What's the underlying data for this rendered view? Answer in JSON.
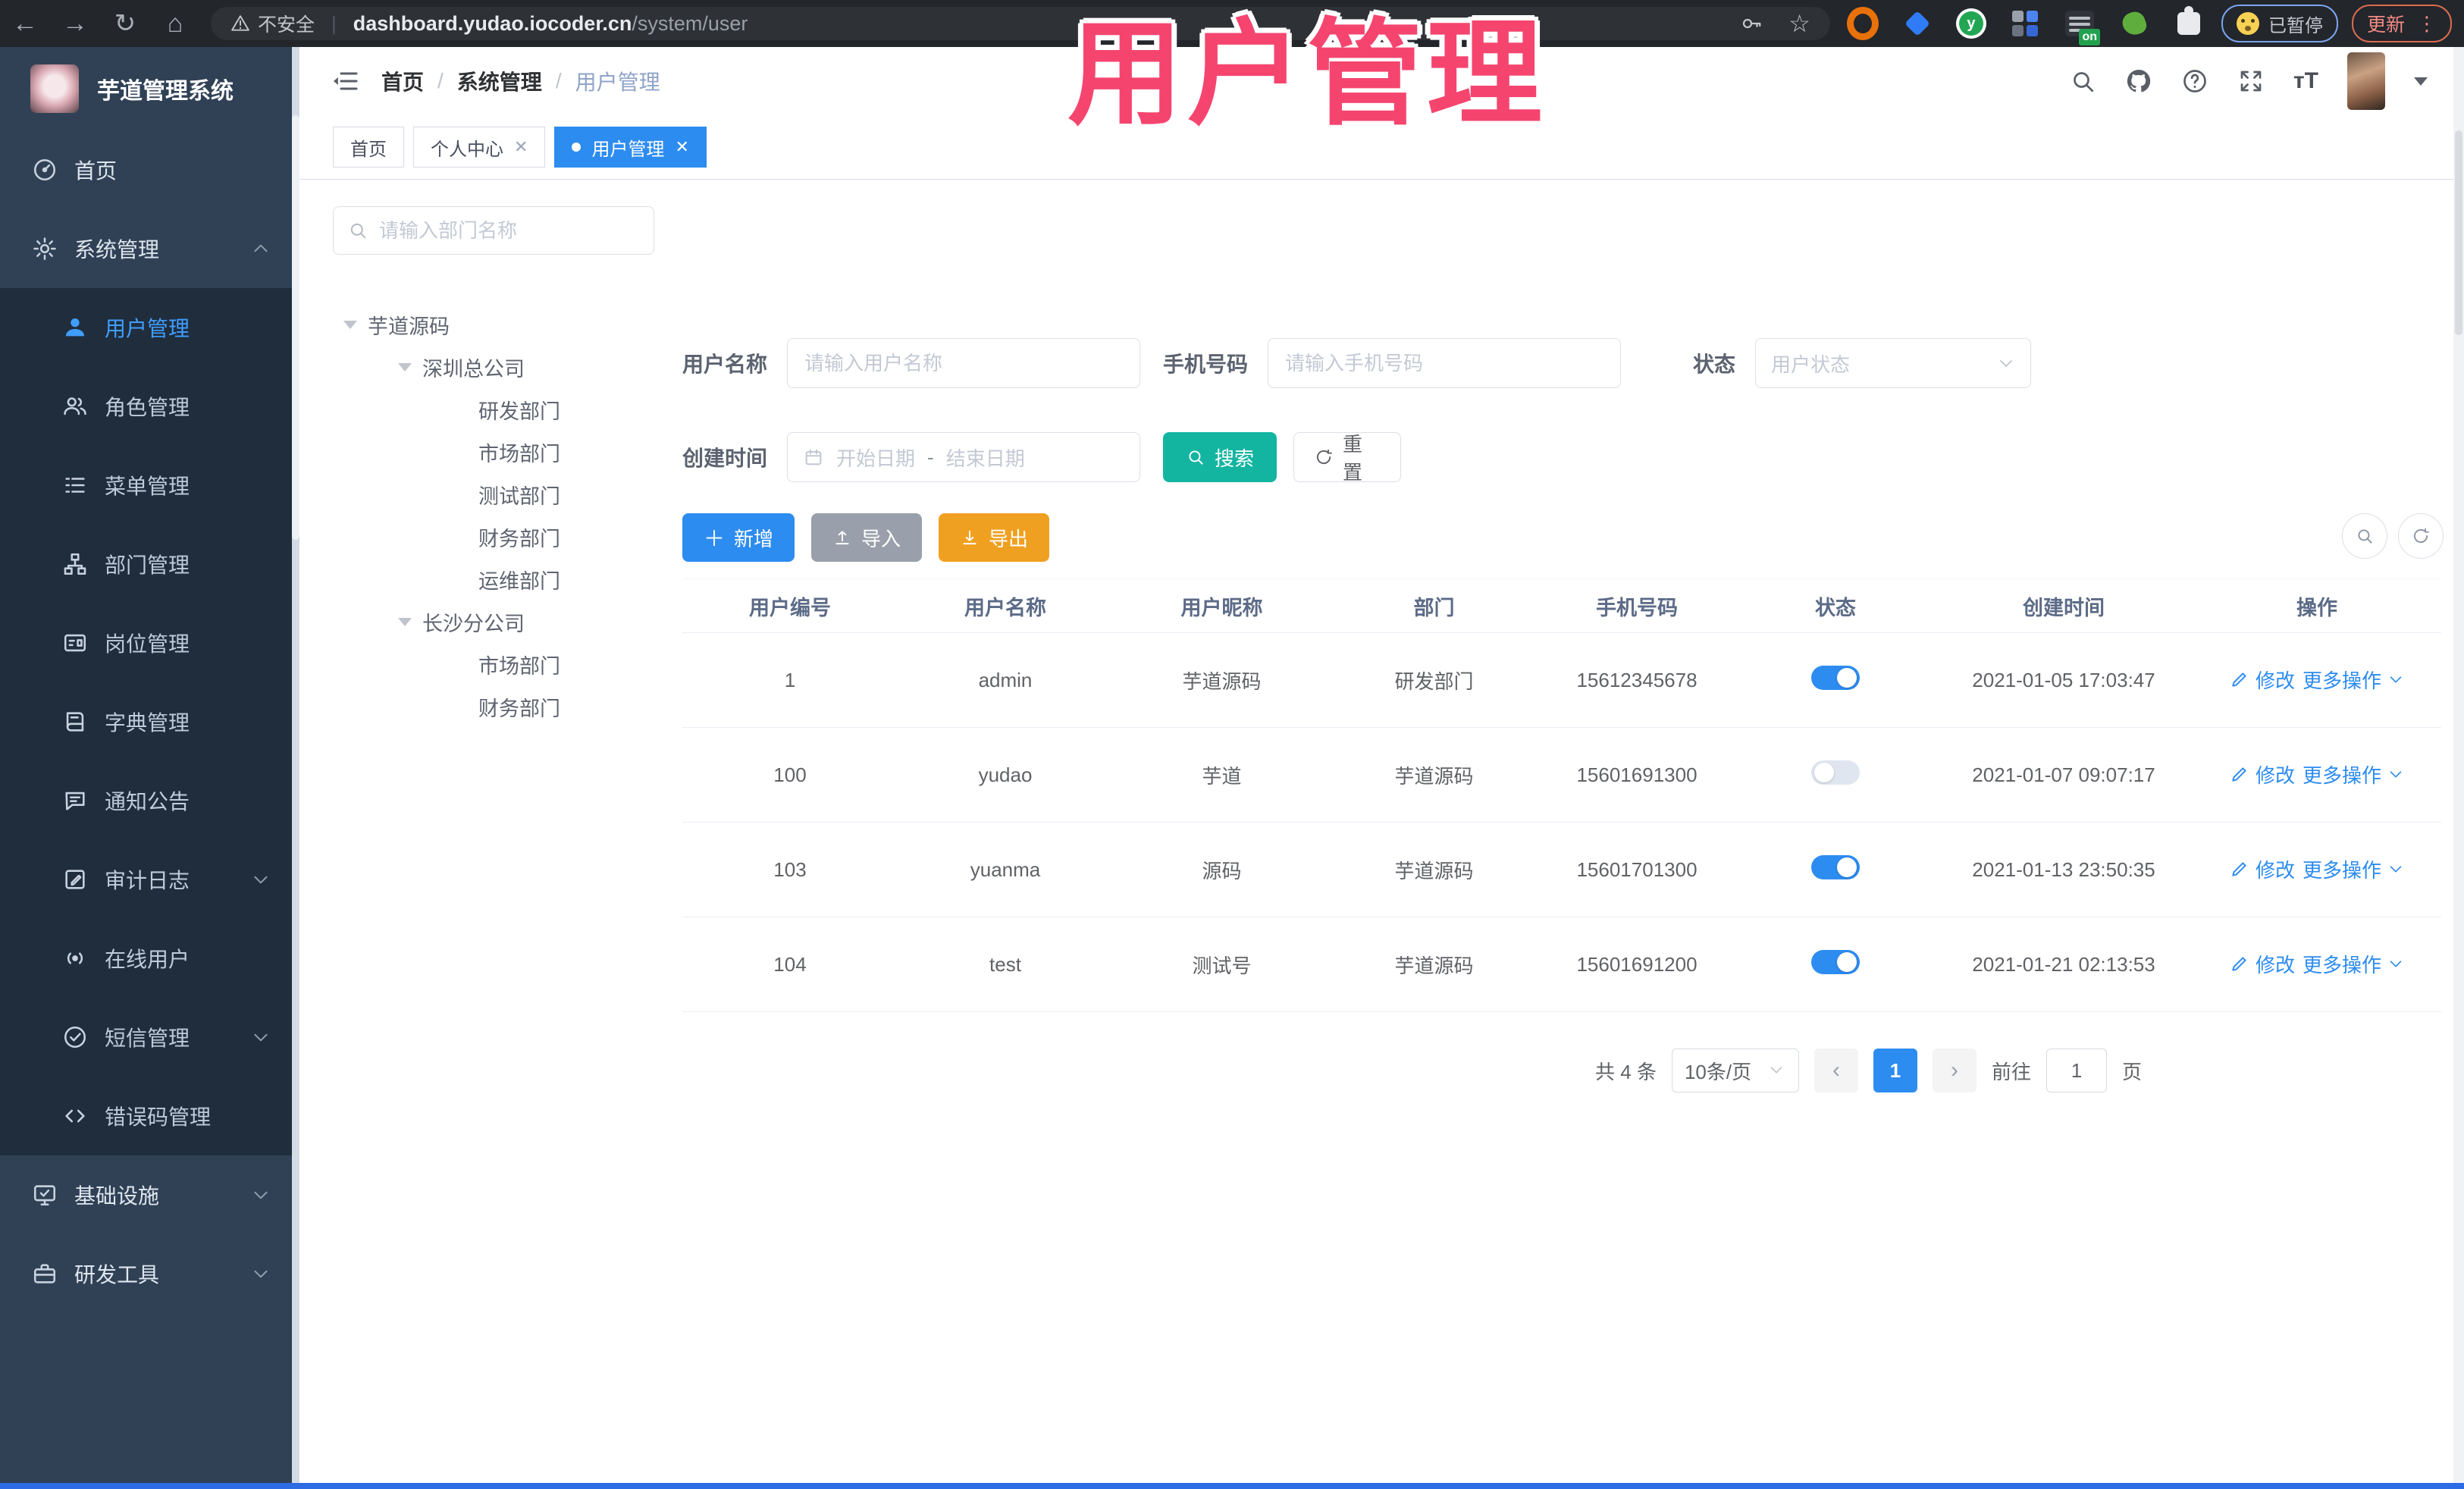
{
  "colors": {
    "accent": "#2d8cf0",
    "teal": "#13b5a1",
    "warning": "#f0a020",
    "sidebar_bg": "#304156",
    "submenu_bg": "#1f2d3d",
    "annotation": "#f5456f",
    "toggle_on": "#2d8cf0"
  },
  "annotation": {
    "text": "用户管理"
  },
  "browser": {
    "warning_label": "不安全",
    "url_host": "dashboard.yudao.iocoder.cn",
    "url_path": "/system/user",
    "extension_on_badge": "on",
    "profile_status": "已暂停",
    "update_label": "更新",
    "menu_dots": "⋮"
  },
  "sidebar": {
    "logo_title": "芋道管理系统",
    "items": [
      {
        "label": "首页",
        "icon": "dashboard-icon"
      },
      {
        "label": "系统管理",
        "icon": "gear-icon",
        "chevron": "up"
      },
      {
        "label": "用户管理",
        "icon": "user-icon",
        "active": true
      },
      {
        "label": "角色管理",
        "icon": "users-icon"
      },
      {
        "label": "菜单管理",
        "icon": "menu-list-icon"
      },
      {
        "label": "部门管理",
        "icon": "org-tree-icon"
      },
      {
        "label": "岗位管理",
        "icon": "id-card-icon"
      },
      {
        "label": "字典管理",
        "icon": "book-icon"
      },
      {
        "label": "通知公告",
        "icon": "megaphone-icon"
      },
      {
        "label": "审计日志",
        "icon": "audit-log-icon",
        "chevron": "down"
      },
      {
        "label": "在线用户",
        "icon": "online-icon"
      },
      {
        "label": "短信管理",
        "icon": "sms-icon",
        "chevron": "down"
      },
      {
        "label": "错误码管理",
        "icon": "code-icon"
      },
      {
        "label": "基础设施",
        "icon": "infra-icon",
        "chevron": "down"
      },
      {
        "label": "研发工具",
        "icon": "toolbox-icon",
        "chevron": "down"
      }
    ]
  },
  "header": {
    "breadcrumb": {
      "0": "首页",
      "1": "系统管理",
      "2": "用户管理"
    },
    "separator": "/"
  },
  "tabs": [
    {
      "label": "首页",
      "closable": false,
      "active": false
    },
    {
      "label": "个人中心",
      "closable": true,
      "active": false
    },
    {
      "label": "用户管理",
      "closable": true,
      "active": true
    }
  ],
  "tree": {
    "search_placeholder": "请输入部门名称",
    "nodes": [
      {
        "label": "芋道源码",
        "level": 0,
        "expanded": true
      },
      {
        "label": "深圳总公司",
        "level": 1,
        "expanded": true
      },
      {
        "label": "研发部门",
        "level": 2
      },
      {
        "label": "市场部门",
        "level": 2
      },
      {
        "label": "测试部门",
        "level": 2
      },
      {
        "label": "财务部门",
        "level": 2
      },
      {
        "label": "运维部门",
        "level": 2
      },
      {
        "label": "长沙分公司",
        "level": 1,
        "expanded": true
      },
      {
        "label": "市场部门2",
        "level": 2,
        "text": "市场部门"
      },
      {
        "label": "财务部门2",
        "level": 2,
        "text": "财务部门"
      }
    ]
  },
  "filters": {
    "username_label": "用户名称",
    "username_placeholder": "请输入用户名称",
    "mobile_label": "手机号码",
    "mobile_placeholder": "请输入手机号码",
    "status_label": "状态",
    "status_placeholder": "用户状态",
    "createtime_label": "创建时间",
    "date_start": "开始日期",
    "date_separator": "-",
    "date_end": "结束日期",
    "search_label": "搜索",
    "reset_label": "重置"
  },
  "toolbar": {
    "add_label": "新增",
    "import_label": "导入",
    "export_label": "导出"
  },
  "table": {
    "columns": [
      "用户编号",
      "用户名称",
      "用户昵称",
      "部门",
      "手机号码",
      "状态",
      "创建时间",
      "操作"
    ],
    "actions": {
      "edit": "修改",
      "more": "更多操作"
    },
    "rows": [
      {
        "id": "1",
        "username": "admin",
        "nickname": "芋道源码",
        "dept": "研发部门",
        "mobile": "15612345678",
        "status": "on",
        "created": "2021-01-05 17:03:47"
      },
      {
        "id": "100",
        "username": "yudao",
        "nickname": "芋道",
        "dept": "芋道源码",
        "mobile": "15601691300",
        "status": "off",
        "created": "2021-01-07 09:07:17"
      },
      {
        "id": "103",
        "username": "yuanma",
        "nickname": "源码",
        "dept": "芋道源码",
        "mobile": "15601701300",
        "status": "on",
        "created": "2021-01-13 23:50:35"
      },
      {
        "id": "104",
        "username": "test",
        "nickname": "测试号",
        "dept": "芋道源码",
        "mobile": "15601691200",
        "status": "on",
        "created": "2021-01-21 02:13:53"
      }
    ]
  },
  "pagination": {
    "total_text": "共 4 条",
    "page_size": "10条/页",
    "prev": "‹",
    "next": "›",
    "current_page": "1",
    "goto_label": "前往",
    "goto_value": "1",
    "page_unit": "页"
  }
}
